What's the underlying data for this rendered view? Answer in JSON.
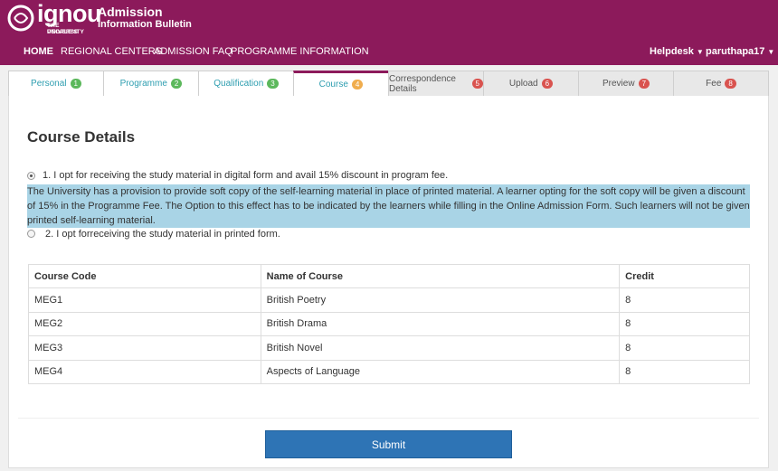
{
  "brand": {
    "logo_text": "ignou",
    "logo_sub1": "THE PEOPLE'S",
    "logo_sub2": "UNIVERSITY",
    "title": "Admission",
    "subtitle": "Information Bulletin"
  },
  "nav": {
    "home": "HOME",
    "regional": "REGIONAL CENTERS",
    "faq": "ADMISSION FAQ",
    "programme_info": "PROGRAMME INFORMATION",
    "helpdesk": "Helpdesk",
    "user": "paruthapa17"
  },
  "tabs": [
    {
      "label": "Personal",
      "badge": "1"
    },
    {
      "label": "Programme",
      "badge": "2"
    },
    {
      "label": "Qualification",
      "badge": "3"
    },
    {
      "label": "Course",
      "badge": "4"
    },
    {
      "label": "Correspondence Details",
      "badge": "5"
    },
    {
      "label": "Upload",
      "badge": "6"
    },
    {
      "label": "Preview",
      "badge": "7"
    },
    {
      "label": "Fee",
      "badge": "8"
    }
  ],
  "main": {
    "title": "Course Details",
    "option1": "1. I opt for receiving the study material in digital form and avail 15% discount in program fee.",
    "info": "The University has a provision to provide soft copy of the self-learning material in place of printed material. A learner opting for the soft copy will be given a discount of 15% in the Programme Fee. The Option to this effect has to be indicated by the learners while filling in the Online Admission Form. Such learners will not be given printed self-learning material.",
    "option2": "2. I opt forreceiving the study material in printed form.",
    "submit": "Submit"
  },
  "table": {
    "headers": [
      "Course Code",
      "Name of Course",
      "Credit"
    ],
    "rows": [
      [
        "MEG1",
        "British Poetry",
        "8"
      ],
      [
        "MEG2",
        "British Drama",
        "8"
      ],
      [
        "MEG3",
        "British Novel",
        "8"
      ],
      [
        "MEG4",
        "Aspects of Language",
        "8"
      ]
    ]
  },
  "colors": {
    "brand": "#8c1a5b",
    "tab_text": "#2e9eb0",
    "info_bg": "#a9d4e6",
    "submit_bg": "#2e74b5"
  }
}
